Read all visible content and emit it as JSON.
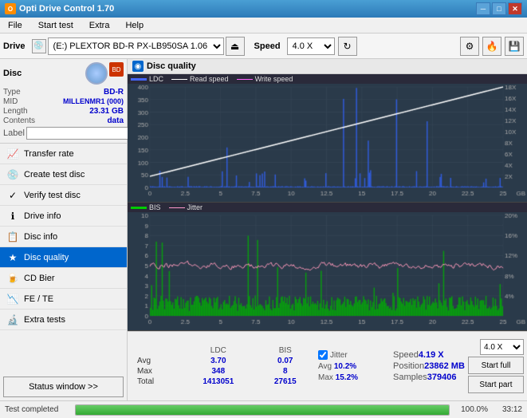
{
  "titleBar": {
    "title": "Opti Drive Control 1.70",
    "minBtn": "─",
    "maxBtn": "□",
    "closeBtn": "✕"
  },
  "menuBar": {
    "items": [
      "File",
      "Start test",
      "Extra",
      "Help"
    ]
  },
  "toolbar": {
    "driveLabel": "Drive",
    "driveValue": "(E:)  PLEXTOR BD-R  PX-LB950SA 1.06",
    "speedLabel": "Speed",
    "speedValue": "4.0 X"
  },
  "disc": {
    "title": "Disc",
    "typeLabel": "Type",
    "typeValue": "BD-R",
    "midLabel": "MID",
    "midValue": "MILLENMR1 (000)",
    "lengthLabel": "Length",
    "lengthValue": "23.31 GB",
    "contentsLabel": "Contents",
    "contentsValue": "data",
    "labelLabel": "Label",
    "labelValue": ""
  },
  "navItems": [
    {
      "id": "transfer-rate",
      "label": "Transfer rate",
      "icon": "📈"
    },
    {
      "id": "create-test-disc",
      "label": "Create test disc",
      "icon": "💿"
    },
    {
      "id": "verify-test-disc",
      "label": "Verify test disc",
      "icon": "✓"
    },
    {
      "id": "drive-info",
      "label": "Drive info",
      "icon": "ℹ"
    },
    {
      "id": "disc-info",
      "label": "Disc info",
      "icon": "📋"
    },
    {
      "id": "disc-quality",
      "label": "Disc quality",
      "icon": "★",
      "active": true
    },
    {
      "id": "cd-bier",
      "label": "CD Bier",
      "icon": "🍺"
    },
    {
      "id": "fe-te",
      "label": "FE / TE",
      "icon": "📉"
    },
    {
      "id": "extra-tests",
      "label": "Extra tests",
      "icon": "🔬"
    }
  ],
  "statusWindowBtn": "Status window >>",
  "chartTitle": "Disc quality",
  "legend1": {
    "items": [
      {
        "label": "LDC",
        "color": "#4466ff"
      },
      {
        "label": "Read speed",
        "color": "#ffffff"
      },
      {
        "label": "Write speed",
        "color": "#ff66ff"
      }
    ]
  },
  "legend2": {
    "items": [
      {
        "label": "BIS",
        "color": "#00cc00"
      },
      {
        "label": "Jitter",
        "color": "#ff99cc"
      }
    ]
  },
  "stats": {
    "columns": [
      "LDC",
      "BIS"
    ],
    "rows": [
      {
        "label": "Avg",
        "ldc": "3.70",
        "bis": "0.07"
      },
      {
        "label": "Max",
        "ldc": "348",
        "bis": "8"
      },
      {
        "label": "Total",
        "ldc": "1413051",
        "bis": "27615"
      }
    ],
    "jitter": {
      "label": "Jitter",
      "avg": "10.2%",
      "max": "15.2%"
    },
    "speed": {
      "label": "Speed",
      "value": "4.19 X",
      "positionLabel": "Position",
      "positionValue": "23862 MB",
      "samplesLabel": "Samples",
      "samplesValue": "379406"
    },
    "speedSelect": "4.0 X",
    "startFull": "Start full",
    "startPart": "Start part"
  },
  "progress": {
    "statusText": "Test completed",
    "percent": "100.0%",
    "time": "33:12"
  }
}
